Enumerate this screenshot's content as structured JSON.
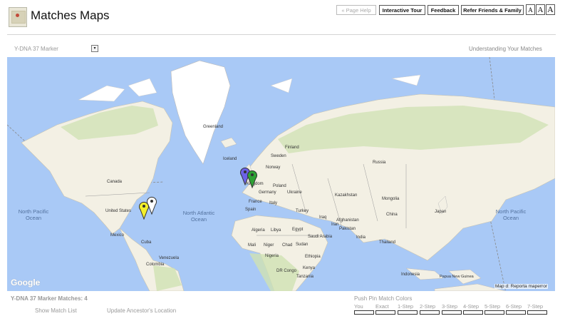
{
  "header": {
    "title": "Matches Maps",
    "page_help": "« Page Help",
    "interactive_tour": "Interactive Tour",
    "feedback": "Feedback",
    "refer": "Refer Friends & Family",
    "font_sizes": [
      "A",
      "A",
      "A"
    ]
  },
  "controls": {
    "marker_select": "Y-DNA 37 Marker",
    "dropdown_arrow": "▾",
    "understanding_link": "Understanding Your Matches"
  },
  "map": {
    "labels": {
      "greenland": "Greenland",
      "iceland": "Iceland",
      "finland": "Finland",
      "sweden": "Sweden",
      "norway": "Norway",
      "russia": "Russia",
      "canada": "Canada",
      "united_states": "United States",
      "mexico": "Mexico",
      "cuba": "Cuba",
      "venezuela": "Venezuela",
      "colombia": "Colombia",
      "poland": "Poland",
      "germany": "Germany",
      "ukraine": "Ukraine",
      "france": "France",
      "spain": "Spain",
      "italy": "Italy",
      "turkey": "Turkey",
      "kazakhstan": "Kazakhstan",
      "mongolia": "Mongolia",
      "china": "China",
      "japan": "Japan",
      "iran": "Iran",
      "iraq": "Iraq",
      "afghanistan": "Afghanistan",
      "pakistan": "Pakistan",
      "india": "India",
      "thailand": "Thailand",
      "indonesia": "Indonesia",
      "png": "Papua New Guinea",
      "algeria": "Algeria",
      "libya": "Libya",
      "egypt": "Egypt",
      "saudi": "Saudi Arabia",
      "mali": "Mali",
      "niger": "Niger",
      "chad": "Chad",
      "sudan": "Sudan",
      "nigeria": "Nigeria",
      "ethiopia": "Ethiopia",
      "drc": "DR Congo",
      "kenya": "Kenya",
      "tanzania": "Tanzania",
      "kingdom": "Kingdom",
      "north_pacific_left": "North Pacific Ocean",
      "north_atlantic": "North Atlantic Ocean",
      "north_pacific_right": "North Pacific Ocean"
    },
    "watermark": "Google",
    "attribution": "Map d: Reporta maperror",
    "pins": [
      {
        "color": "#f2ef2d",
        "name": "yellow-pin"
      },
      {
        "color": "#ffffff",
        "name": "white-pin"
      },
      {
        "color": "#6b61e6",
        "name": "purple-pin"
      },
      {
        "color": "#2ea135",
        "name": "green-pin"
      }
    ],
    "colors": {
      "water": "#a9c9f6",
      "land": "#f3f0e4",
      "land_green": "#cfe2b3",
      "ice": "#ffffff",
      "border": "#8a8a8a"
    }
  },
  "footer": {
    "matches_label": "Y-DNA 37 Marker Matches: 4",
    "show_match_list": "Show Match List",
    "update_location": "Update Ancestor's Location",
    "push_pin_title": "Push Pin Match Colors",
    "pin_keys": [
      "You",
      "Exact",
      "1-Step",
      "2-Step",
      "3-Step",
      "4-Step",
      "5-Step",
      "6-Step",
      "7-Step"
    ]
  }
}
